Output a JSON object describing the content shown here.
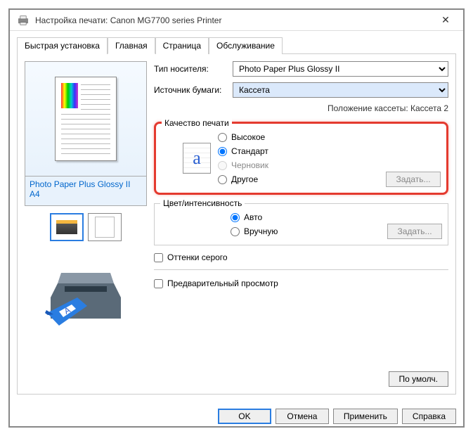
{
  "window": {
    "title": "Настройка печати: Canon MG7700 series Printer",
    "close": "✕"
  },
  "tabs": {
    "quick": "Быстрая установка",
    "main": "Главная",
    "page": "Страница",
    "service": "Обслуживание"
  },
  "labels": {
    "media_type": "Тип носителя:",
    "paper_source": "Источник бумаги:",
    "cassette_pos": "Положение кассеты: Кассета 2",
    "quality_group": "Качество печати",
    "color_group": "Цвет/интенсивность",
    "grayscale": "Оттенки серого",
    "preview": "Предварительный просмотр",
    "set": "Задать...",
    "defaults": "По умолч."
  },
  "dropdowns": {
    "media_type_value": "Photo Paper Plus Glossy II",
    "paper_source_value": "Кассета"
  },
  "quality": {
    "high": "Высокое",
    "standard": "Стандарт",
    "draft": "Черновик",
    "other": "Другое",
    "icon_letter": "a"
  },
  "color": {
    "auto": "Авто",
    "manual": "Вручную"
  },
  "preview": {
    "paper_label": "Photo Paper Plus Glossy II A4"
  },
  "buttons": {
    "ok": "OK",
    "cancel": "Отмена",
    "apply": "Применить",
    "help": "Справка"
  }
}
